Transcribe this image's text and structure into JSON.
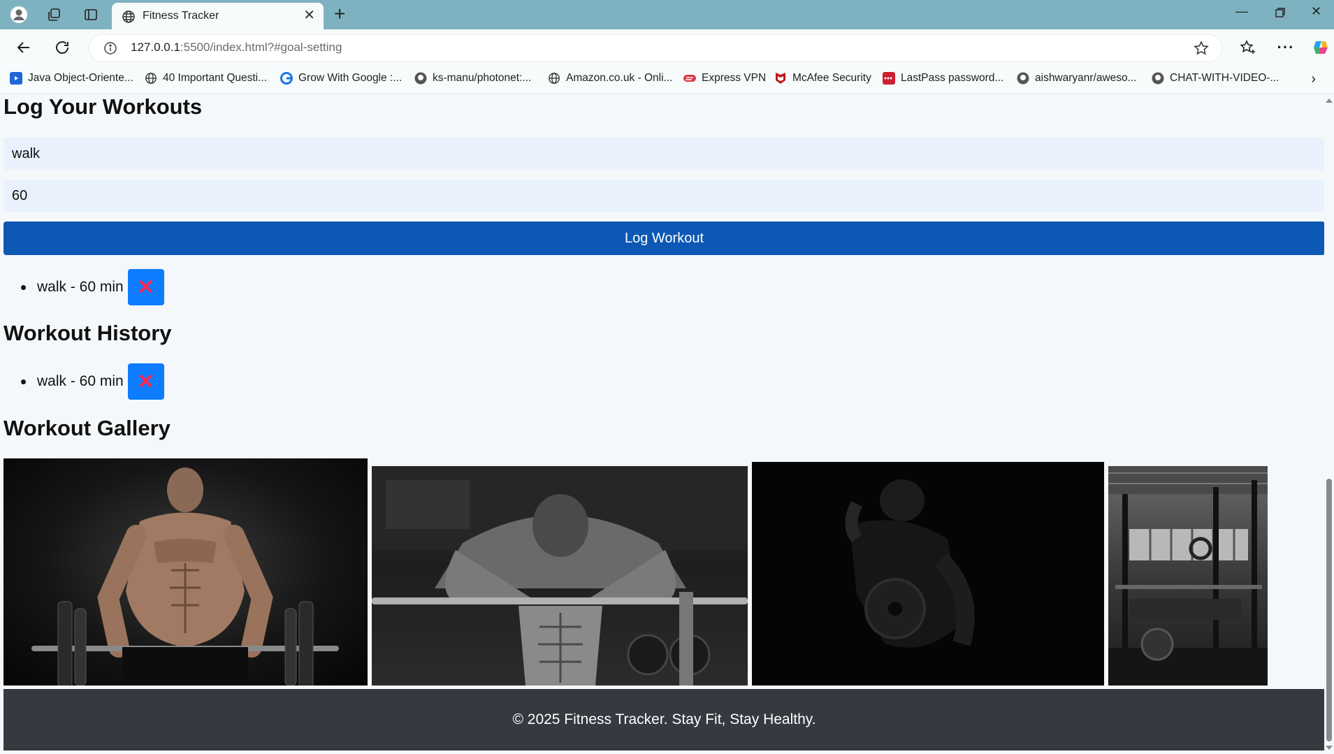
{
  "browser": {
    "tab_title": "Fitness Tracker",
    "url_host": "127.0.0.1",
    "url_rest": ":5500/index.html?#goal-setting",
    "bookmarks": [
      {
        "label": "Java Object-Oriente...",
        "icon": "video-icon",
        "color": "#1e66d6"
      },
      {
        "label": "40 Important Questi...",
        "icon": "globe-icon",
        "color": "#333333"
      },
      {
        "label": "Grow With Google :...",
        "icon": "google-icon",
        "color": "#1a73e8"
      },
      {
        "label": "ks-manu/photonet:...",
        "icon": "github-icon",
        "color": "#333333"
      },
      {
        "label": "Amazon.co.uk - Onli...",
        "icon": "globe-icon",
        "color": "#333333"
      },
      {
        "label": "Express VPN",
        "icon": "expressvpn-icon",
        "color": "#da3940"
      },
      {
        "label": "McAfee Security",
        "icon": "mcafee-icon",
        "color": "#c01818"
      },
      {
        "label": "LastPass password...",
        "icon": "lastpass-icon",
        "color": "#cc1f2f"
      },
      {
        "label": "aishwaryanr/aweso...",
        "icon": "github-icon",
        "color": "#333333"
      },
      {
        "label": "CHAT-WITH-VIDEO-...",
        "icon": "github-icon",
        "color": "#333333"
      }
    ]
  },
  "log_section": {
    "title": "Log Your Workouts",
    "exercise_value": "walk",
    "duration_value": "60",
    "button_label": "Log Workout",
    "entries": [
      {
        "text": "walk - 60 min",
        "delete_glyph": "✕"
      }
    ]
  },
  "history_section": {
    "title": "Workout History",
    "entries": [
      {
        "text": "walk - 60 min",
        "delete_glyph": "✕"
      }
    ]
  },
  "gallery_section": {
    "title": "Workout Gallery",
    "images": [
      "barbell-curl-photo",
      "man-leaning-on-bar-photo",
      "dark-weight-plate-photo",
      "gym-rack-photo"
    ]
  },
  "footer": {
    "text": "© 2025 Fitness Tracker. Stay Fit, Stay Healthy."
  },
  "colors": {
    "accent": "#0d58b4",
    "delete_button": "#0d7cff",
    "delete_icon": "#ff2a4f",
    "footer_bg": "#343a40"
  }
}
